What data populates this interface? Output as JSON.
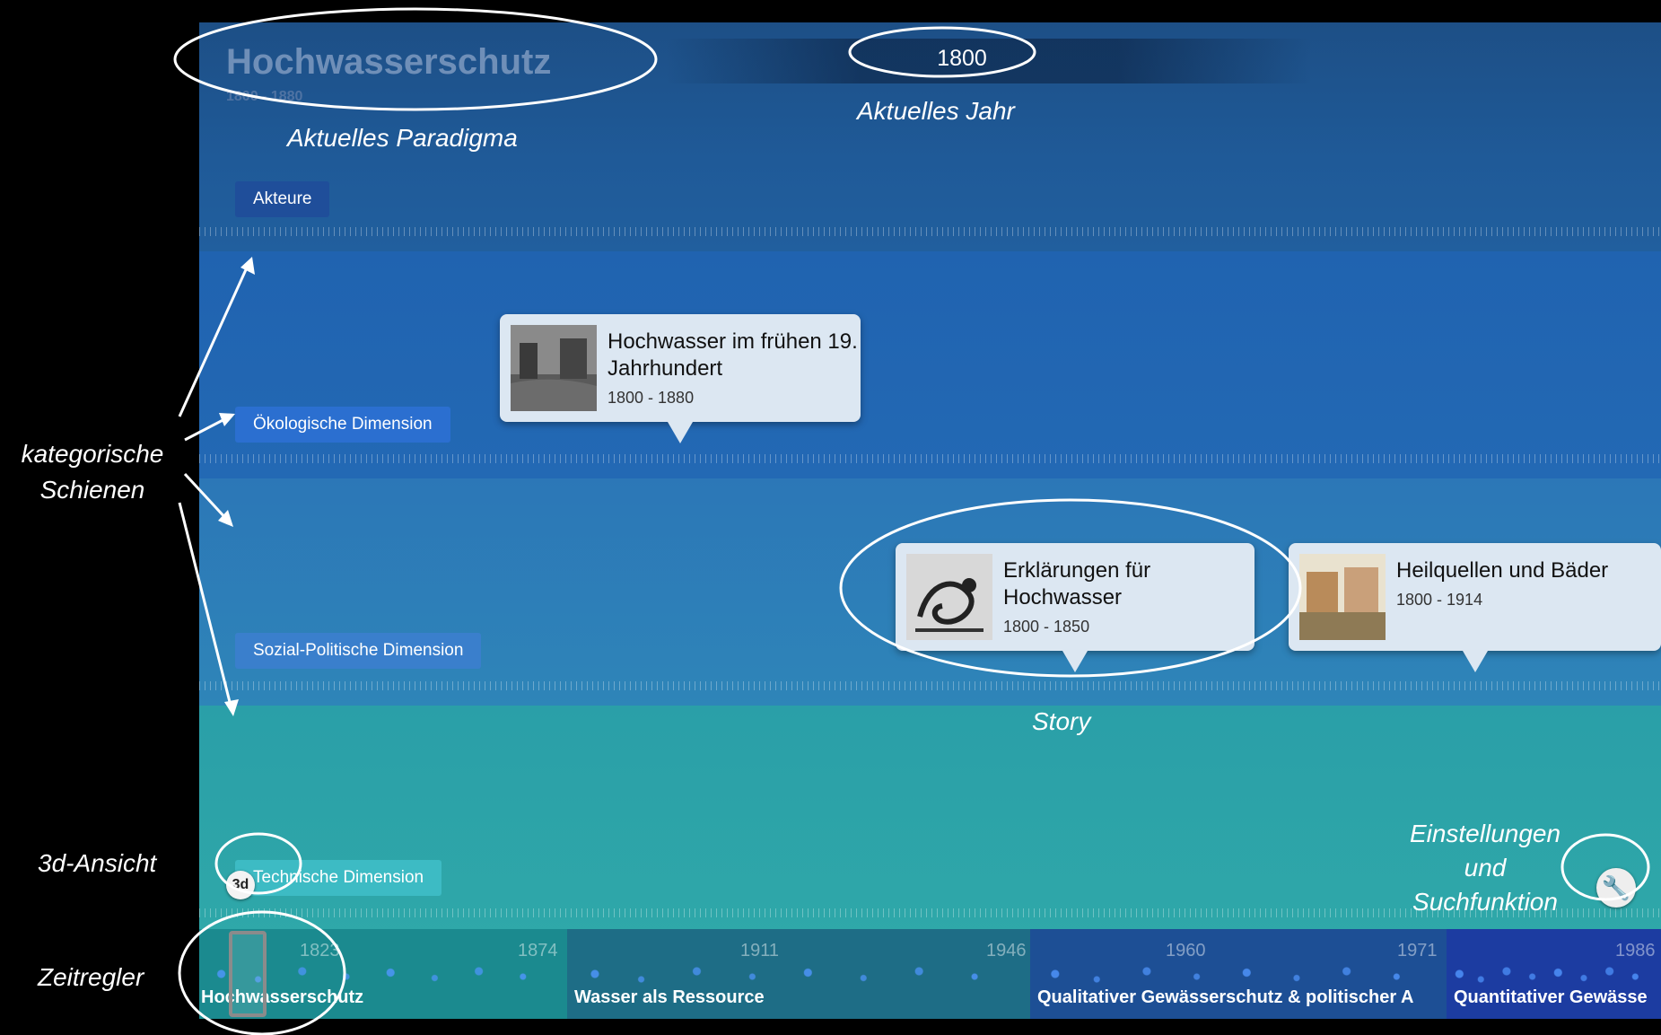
{
  "header": {
    "paradigm_title": "Hochwasserschutz",
    "paradigm_range": "1800 - 1880",
    "current_year": "1800"
  },
  "categories": [
    {
      "label": "Akteure",
      "color": "#1f4e9a"
    },
    {
      "label": "Ökologische Dimension",
      "color": "#2b6fd0"
    },
    {
      "label": "Sozial-Politische Dimension",
      "color": "#3a7fcc"
    },
    {
      "label": "Technische Dimension",
      "color": "#3dbbc4"
    }
  ],
  "stories": [
    {
      "title": "Hochwasser im frühen 19. Jahrhundert",
      "range": "1800 - 1880"
    },
    {
      "title": "Erklärungen für Hochwasser",
      "range": "1800 - 1850"
    },
    {
      "title": "Heilquellen und Bäder",
      "range": "1800 - 1914"
    }
  ],
  "controls": {
    "view_3d_label": "3d",
    "settings_icon": "wrench-icon"
  },
  "timeline": {
    "segments": [
      {
        "title": "Hochwasserschutz",
        "ticks": [
          "1823",
          "1874"
        ],
        "color": "#1b8a8f"
      },
      {
        "title": "Wasser als Ressource",
        "ticks": [
          "1911",
          "1946"
        ],
        "color": "#1e6d86"
      },
      {
        "title": "Qualitativer Gewässerschutz & politischer A",
        "ticks": [
          "1960",
          "1971"
        ],
        "color": "#1d4f95"
      },
      {
        "title": "Quantitativer Gewässe",
        "ticks": [
          "1986"
        ],
        "color": "#1c3ca1"
      }
    ]
  },
  "annotations": {
    "paradigm": "Aktuelles Paradigma",
    "year": "Aktuelles Jahr",
    "rails": "kategorische Schienen",
    "story": "Story",
    "view3d": "3d-Ansicht",
    "settings": "Einstellungen und Suchfunktion",
    "time_slider": "Zeitregler"
  }
}
